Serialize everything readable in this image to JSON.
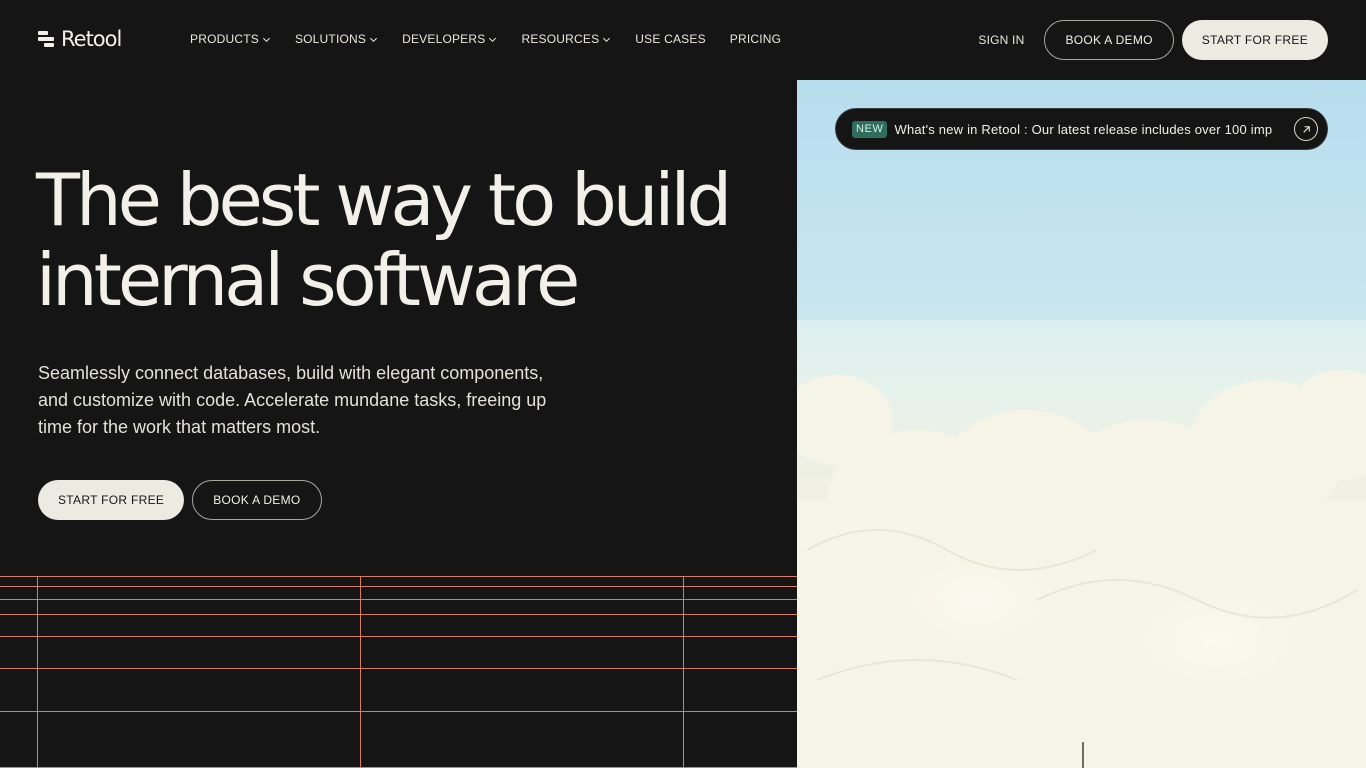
{
  "brand": {
    "name": "Retool"
  },
  "nav": {
    "items": [
      {
        "label": "PRODUCTS",
        "has_dropdown": true
      },
      {
        "label": "SOLUTIONS",
        "has_dropdown": true
      },
      {
        "label": "DEVELOPERS",
        "has_dropdown": true
      },
      {
        "label": "RESOURCES",
        "has_dropdown": true
      },
      {
        "label": "USE CASES",
        "has_dropdown": false
      },
      {
        "label": "PRICING",
        "has_dropdown": false
      }
    ],
    "sign_in": "SIGN IN",
    "book_demo": "BOOK A DEMO",
    "start_free": "START FOR FREE"
  },
  "hero": {
    "title_line1": "The best way to build",
    "title_line2": "internal software",
    "subtitle": "Seamlessly connect databases, build with elegant components, and customize with code. Accelerate mundane tasks, freeing up time for the work that matters most.",
    "cta_primary": "START FOR FREE",
    "cta_secondary": "BOOK A DEMO"
  },
  "announcement": {
    "badge": "NEW",
    "text": "What's new in Retool :  Our latest release includes over 100 imp"
  },
  "icons": {
    "logo": "retool-logo-icon",
    "dropdown": "chevron-down-icon",
    "announcement_link": "arrow-up-right-icon"
  },
  "colors": {
    "background": "#151515",
    "text": "#f2f0e8",
    "button_light": "#ecebe1",
    "grid_lines": "#d97c63",
    "badge": "#2f6e5e"
  }
}
